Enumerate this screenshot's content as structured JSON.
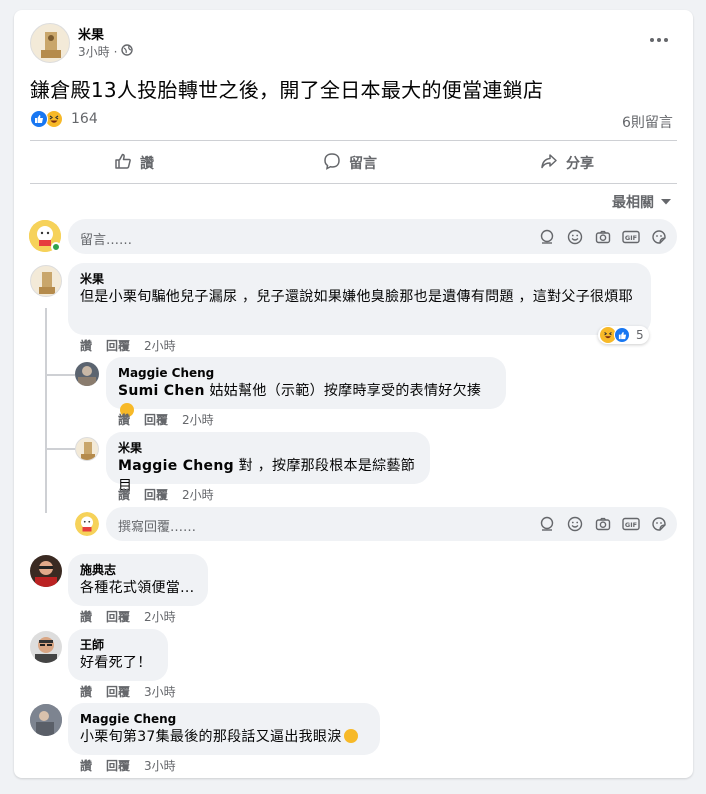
{
  "post": {
    "author": "米果",
    "time": "3小時",
    "privacy_separator": "·",
    "title": "鎌倉殿13人投胎轉世之後，開了全日本最大的便當連鎖店",
    "reaction_count": "164",
    "comments_count": "6則留言",
    "like_label": "讚",
    "comment_label": "留言",
    "share_label": "分享",
    "sort_label": "最相關"
  },
  "comment_box": {
    "placeholder": "留言……"
  },
  "comments": [
    {
      "author": "米果",
      "text": "但是小栗旬騙他兒子漏尿 ，兒子還說如果嫌他臭臉那也是遺傳有問題 ，這對父子很煩耶",
      "like": "讚",
      "reply": "回覆",
      "time": "2小時",
      "reaction_count": "5"
    },
    {
      "author": "Maggie Cheng",
      "mention": "Sumi Chen",
      "text": " 姑姑幫他（示範）按摩時享受的表情好欠揍",
      "like": "讚",
      "reply": "回覆",
      "time": "2小時"
    },
    {
      "author": "米果",
      "mention": "Maggie Cheng",
      "text": " 對 ，按摩那段根本是綜藝節目",
      "like": "讚",
      "reply": "回覆",
      "time": "2小時"
    },
    {
      "author": "施典志",
      "text": "各種花式領便當...",
      "like": "讚",
      "reply": "回覆",
      "time": "2小時"
    },
    {
      "author": "王師",
      "text": "好看死了！",
      "like": "讚",
      "reply": "回覆",
      "time": "3小時"
    },
    {
      "author": "Maggie Cheng",
      "text": "小栗旬第37集最後的那段話又逼出我眼淚",
      "like": "讚",
      "reply": "回覆",
      "time": "3小時"
    }
  ],
  "reply_box": {
    "placeholder": "撰寫回覆……"
  },
  "colors": {
    "like_blue": "#1877f2",
    "haha_yellow": "#f7b928",
    "muted": "#65676b",
    "online_green": "#31a24c"
  }
}
